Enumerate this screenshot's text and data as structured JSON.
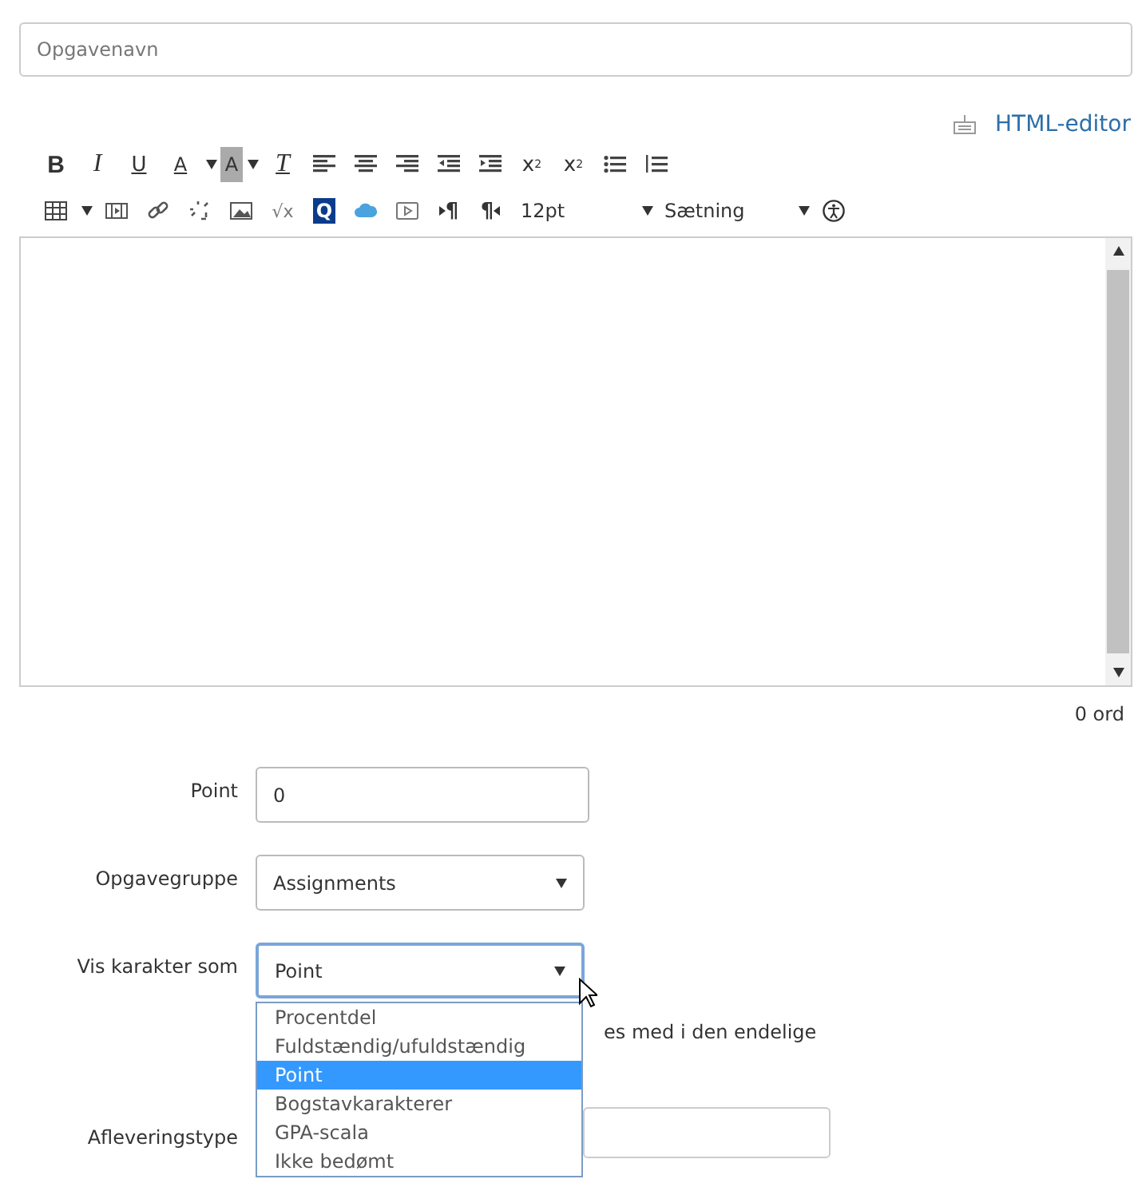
{
  "title_field": {
    "placeholder": "Opgavenavn"
  },
  "html_editor_link": "HTML-editor",
  "toolbar_rows": [
    [
      {
        "kind": "bold",
        "label": "B"
      },
      {
        "kind": "italic",
        "label": "I"
      },
      {
        "kind": "underline",
        "label": "U"
      },
      {
        "kind": "text-color",
        "label": "A"
      },
      {
        "kind": "caret"
      },
      {
        "kind": "highlight",
        "label": "A"
      },
      {
        "kind": "caret"
      },
      {
        "kind": "clear-format",
        "label": "T"
      },
      {
        "kind": "align-left"
      },
      {
        "kind": "align-center"
      },
      {
        "kind": "align-right"
      },
      {
        "kind": "outdent"
      },
      {
        "kind": "indent"
      },
      {
        "kind": "superscript",
        "label": "x",
        "script": "2"
      },
      {
        "kind": "subscript",
        "label": "x",
        "script": "2"
      },
      {
        "kind": "bullet-list"
      },
      {
        "kind": "numbered-list"
      }
    ],
    [
      {
        "kind": "table"
      },
      {
        "kind": "caret"
      },
      {
        "kind": "media"
      },
      {
        "kind": "link"
      },
      {
        "kind": "unlink"
      },
      {
        "kind": "image"
      },
      {
        "kind": "math",
        "label": "√x"
      },
      {
        "kind": "quiz",
        "label": "Q"
      },
      {
        "kind": "cloud"
      },
      {
        "kind": "video"
      },
      {
        "kind": "ltr",
        "label": "¶"
      },
      {
        "kind": "rtl",
        "label": "¶"
      },
      {
        "kind": "select",
        "label": "12pt"
      },
      {
        "kind": "select",
        "label": "Sætning"
      },
      {
        "kind": "accessibility"
      }
    ]
  ],
  "word_count": "0 ord",
  "fields": [
    {
      "kind": "input",
      "label": "Point",
      "value": "0",
      "focused": false
    },
    {
      "kind": "select",
      "label": "Opgavegruppe",
      "value": "Assignments",
      "focused": false
    },
    {
      "kind": "select",
      "label": "Vis karakter som",
      "value": "Point",
      "focused": true
    }
  ],
  "dropdown_options": [
    {
      "label": "Procentdel",
      "selected": false
    },
    {
      "label": "Fuldstændig/ufuldstændig",
      "selected": false
    },
    {
      "label": "Point",
      "selected": true
    },
    {
      "label": "Bogstavkarakterer",
      "selected": false
    },
    {
      "label": "GPA-scala",
      "selected": false
    },
    {
      "label": "Ikke bedømt",
      "selected": false
    }
  ],
  "hidden_checkbox_text": "es med i den endelige",
  "submission_label": "Afleveringstype"
}
